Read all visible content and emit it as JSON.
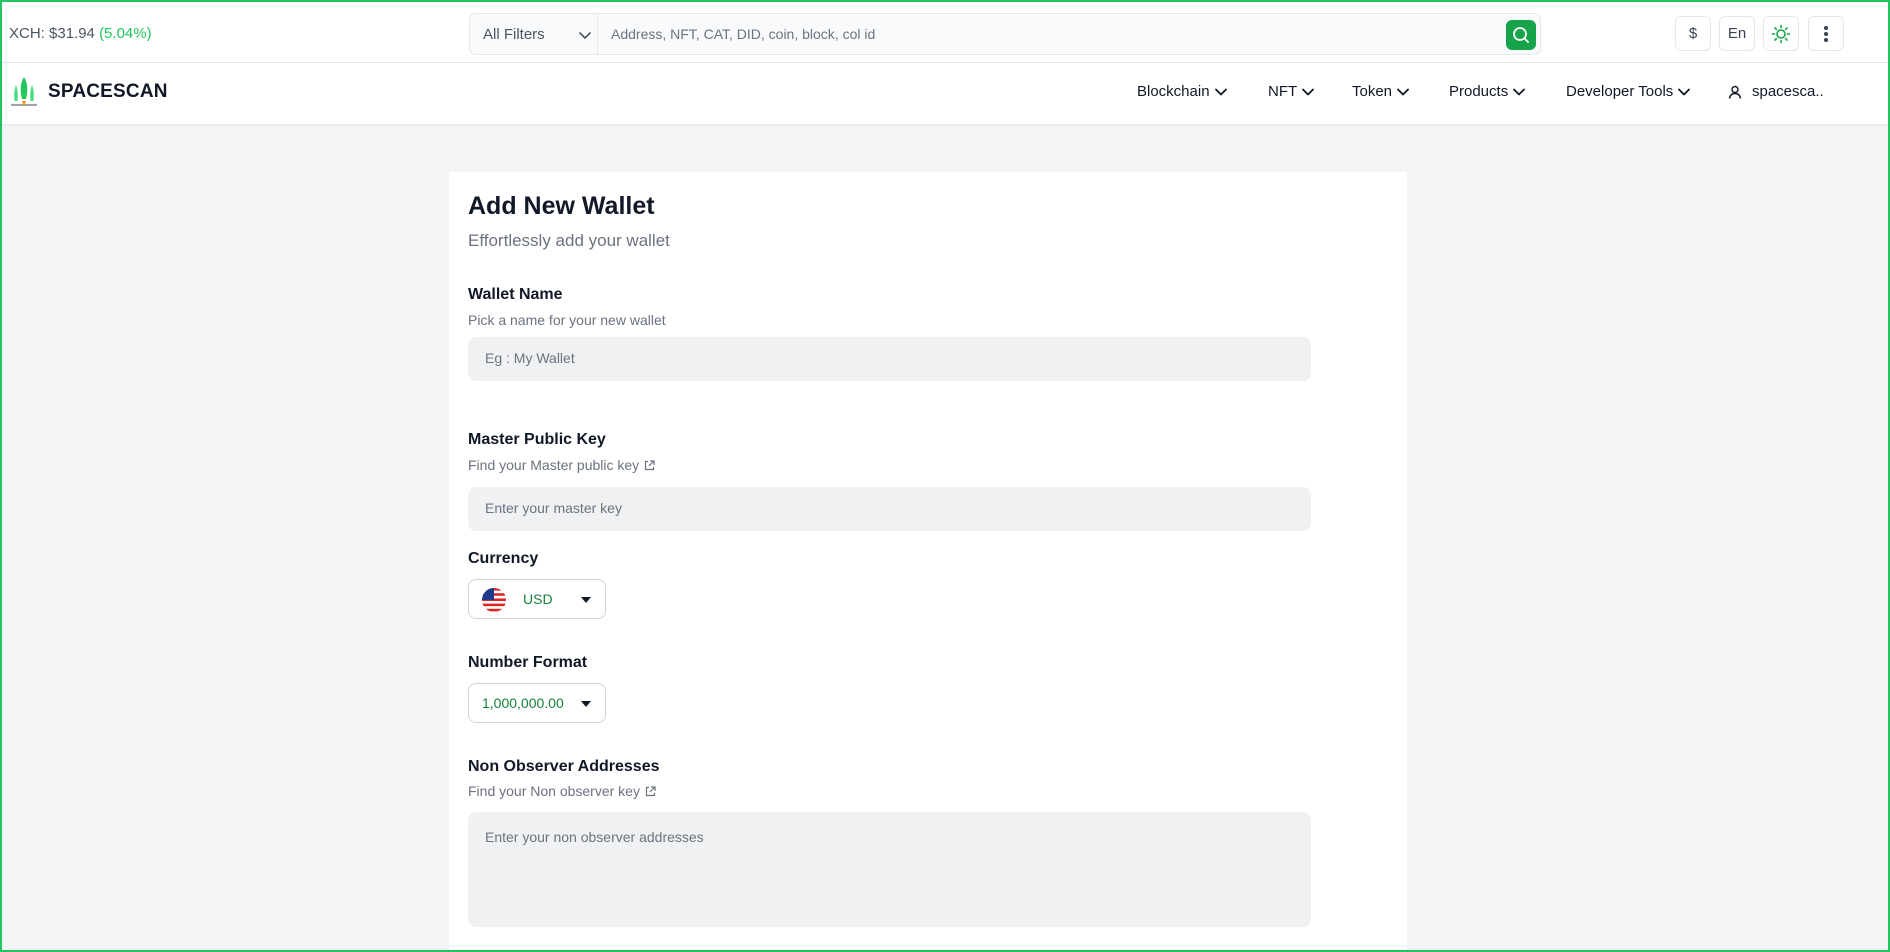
{
  "topbar": {
    "price_label": "XCH: $31.94",
    "price_change": "(5.04%)",
    "filter_label": "All Filters",
    "search_placeholder": "Address, NFT, CAT, DID, coin, block, col id",
    "currency_button": "$",
    "language_button": "En"
  },
  "nav": {
    "brand": "SPACESCAN",
    "items": [
      "Blockchain",
      "NFT",
      "Token",
      "Products",
      "Developer Tools"
    ],
    "user": "spacesca.."
  },
  "form": {
    "title": "Add New Wallet",
    "subtitle": "Effortlessly add your wallet",
    "wallet_name": {
      "label": "Wallet Name",
      "help": "Pick a name for your new wallet",
      "placeholder": "Eg : My Wallet"
    },
    "master_key": {
      "label": "Master Public Key",
      "help": "Find your Master public key",
      "placeholder": "Enter your master key"
    },
    "currency": {
      "label": "Currency",
      "value": "USD"
    },
    "number_format": {
      "label": "Number Format",
      "value": "1,000,000.00"
    },
    "non_observer": {
      "label": "Non Observer Addresses",
      "help": "Find your Non observer key",
      "placeholder": "Enter your non observer addresses"
    }
  },
  "colors": {
    "accent": "#16a34a",
    "positive": "#22c55e",
    "frame": "#22c55e"
  },
  "icons": [
    "search-icon",
    "chevron-down-icon",
    "sun-icon",
    "kebab-menu-icon",
    "user-icon",
    "external-link-icon",
    "us-flag-icon",
    "spacescan-logo-icon"
  ]
}
